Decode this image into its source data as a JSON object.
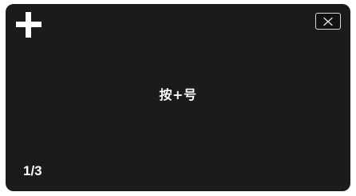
{
  "top_bar": {
    "add_icon": "plus-icon",
    "close_icon": "close-icon"
  },
  "content": {
    "label": "按+号"
  },
  "footer": {
    "page_indicator": "1/3"
  },
  "colors": {
    "screen_background": "#1b1b1b",
    "text": "#ffffff"
  }
}
